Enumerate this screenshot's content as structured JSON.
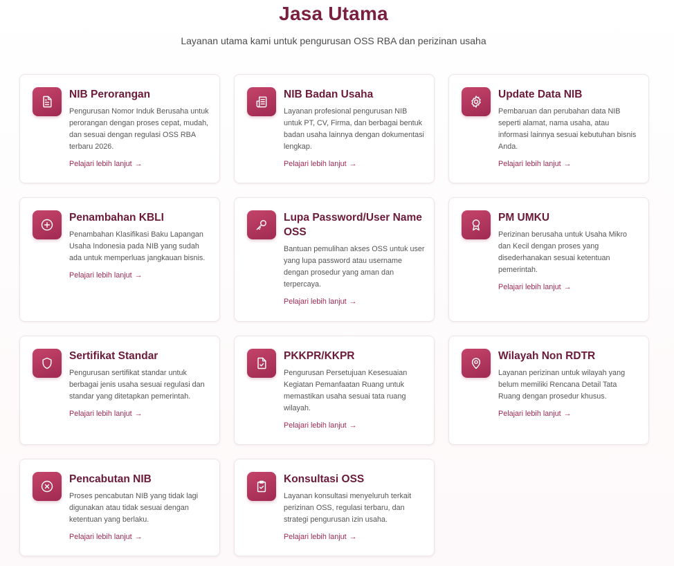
{
  "section": {
    "title": "Jasa Utama",
    "subtitle": "Layanan utama kami untuk pengurusan OSS RBA dan perizinan usaha"
  },
  "link_label": "Pelajari lebih lanjut",
  "accent_color": "#a02a52",
  "title_color": "#6b1a37",
  "cards": [
    {
      "icon": "document-icon",
      "title": "NIB Perorangan",
      "desc": "Pengurusan Nomor Induk Berusaha untuk perorangan dengan proses cepat, mudah, dan sesuai dengan regulasi OSS RBA terbaru 2026."
    },
    {
      "icon": "newspaper-icon",
      "title": "NIB Badan Usaha",
      "desc": "Layanan profesional pengurusan NIB untuk PT, CV, Firma, dan berbagai bentuk badan usaha lainnya dengan dokumentasi lengkap."
    },
    {
      "icon": "gear-icon",
      "title": "Update Data NIB",
      "desc": "Pembaruan dan perubahan data NIB seperti alamat, nama usaha, atau informasi lainnya sesuai kebutuhan bisnis Anda."
    },
    {
      "icon": "plus-circle-icon",
      "title": "Penambahan KBLI",
      "desc": "Penambahan Klasifikasi Baku Lapangan Usaha Indonesia pada NIB yang sudah ada untuk memperluas jangkauan bisnis."
    },
    {
      "icon": "key-icon",
      "title": "Lupa Password/User Name OSS",
      "desc": "Bantuan pemulihan akses OSS untuk user yang lupa password atau username dengan prosedur yang aman dan terpercaya."
    },
    {
      "icon": "award-icon",
      "title": "PM UMKU",
      "desc": "Perizinan berusaha untuk Usaha Mikro dan Kecil dengan proses yang disederhanakan sesuai ketentuan pemerintah."
    },
    {
      "icon": "shield-icon",
      "title": "Sertifikat Standar",
      "desc": "Pengurusan sertifikat standar untuk berbagai jenis usaha sesuai regulasi dan standar yang ditetapkan pemerintah."
    },
    {
      "icon": "file-check-icon",
      "title": "PKKPR/KKPR",
      "desc": "Pengurusan Persetujuan Kesesuaian Kegiatan Pemanfaatan Ruang untuk memastikan usaha sesuai tata ruang wilayah."
    },
    {
      "icon": "map-pin-icon",
      "title": "Wilayah Non RDTR",
      "desc": "Layanan perizinan untuk wilayah yang belum memiliki Rencana Detail Tata Ruang dengan prosedur khusus."
    },
    {
      "icon": "x-circle-icon",
      "title": "Pencabutan NIB",
      "desc": "Proses pencabutan NIB yang tidak lagi digunakan atau tidak sesuai dengan ketentuan yang berlaku."
    },
    {
      "icon": "clipboard-check-icon",
      "title": "Konsultasi OSS",
      "desc": "Layanan konsultasi menyeluruh terkait perizinan OSS, regulasi terbaru, dan strategi pengurusan izin usaha."
    }
  ]
}
